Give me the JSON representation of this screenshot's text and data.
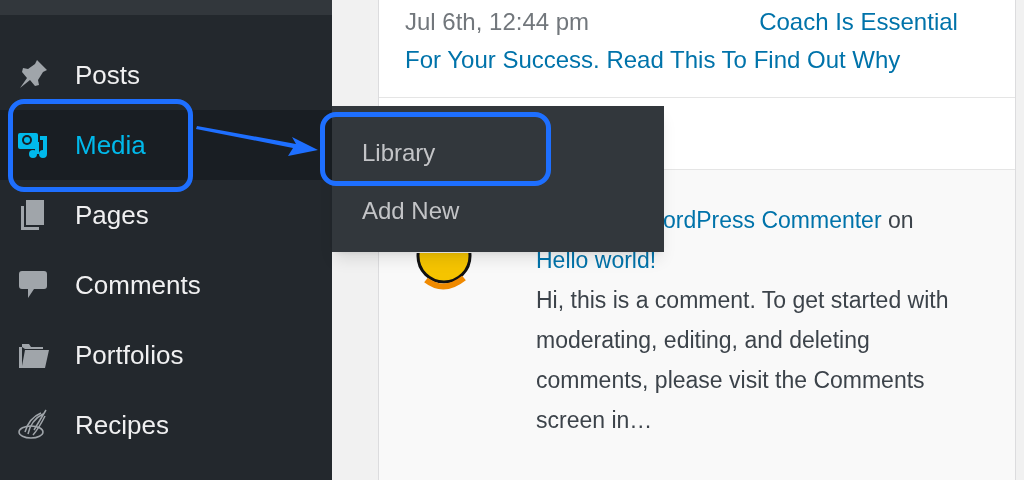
{
  "sidebar": {
    "items": [
      {
        "label": "Posts",
        "kind": "pin",
        "selected": false,
        "callout": false
      },
      {
        "label": "Media",
        "kind": "media",
        "selected": true,
        "callout": true
      },
      {
        "label": "Pages",
        "kind": "pages",
        "selected": false,
        "callout": false
      },
      {
        "label": "Comments",
        "kind": "comment",
        "selected": false,
        "callout": false
      },
      {
        "label": "Portfolios",
        "kind": "folder",
        "selected": false,
        "callout": false
      },
      {
        "label": "Recipes",
        "kind": "whisk",
        "selected": false,
        "callout": false
      }
    ]
  },
  "flyout": {
    "items": [
      {
        "label": "Library",
        "callout": true
      },
      {
        "label": "Add New",
        "callout": false
      }
    ]
  },
  "activity": {
    "post": {
      "date": "Jul 6th, 12:44 pm",
      "title": "Coach Is Essential For Your Success. Read This To Find Out Why"
    },
    "comment": {
      "author": "ordPress Commenter",
      "on": "on",
      "post": "Hello world!",
      "excerpt": "Hi, this is a comment. To get started with moderating, editing, and deleting comments, please visit the Comments screen in…"
    }
  }
}
